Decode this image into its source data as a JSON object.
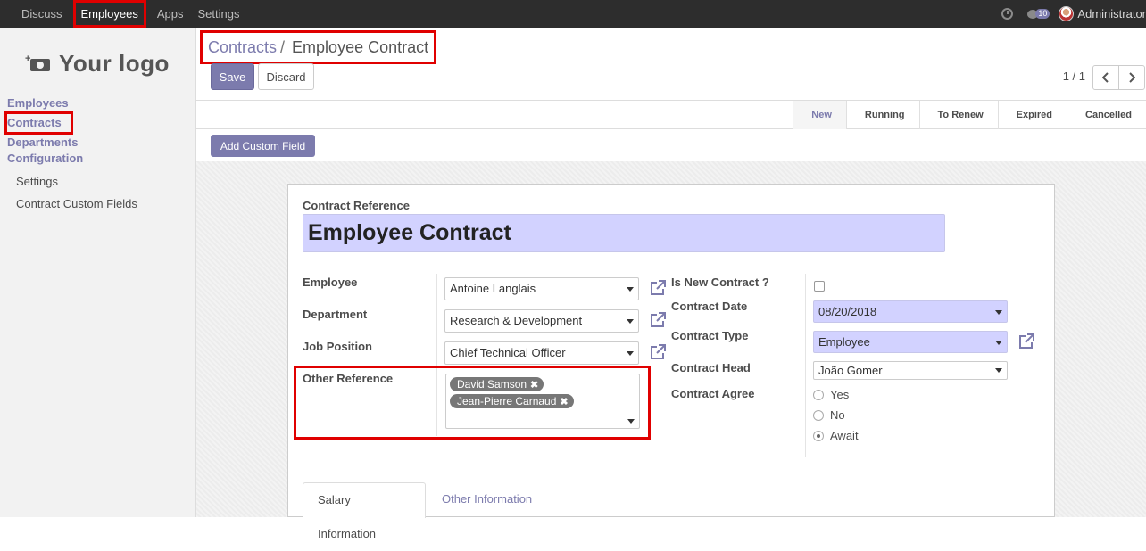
{
  "topbar": {
    "menu": [
      "Discuss",
      "Employees",
      "Apps",
      "Settings"
    ],
    "active_menu": "Employees",
    "message_count": "10",
    "user": "Administrator"
  },
  "sidebar": {
    "logo_text": "Your logo",
    "items": [
      {
        "label": "Employees"
      },
      {
        "label": "Contracts"
      },
      {
        "label": "Departments"
      },
      {
        "label": "Configuration"
      }
    ],
    "sub_items": [
      {
        "label": "Settings"
      },
      {
        "label": "Contract Custom Fields"
      }
    ]
  },
  "breadcrumb": {
    "parent": "Contracts",
    "separator": "/",
    "current": "Employee Contract"
  },
  "toolbar": {
    "save_label": "Save",
    "discard_label": "Discard",
    "pager": "1 / 1"
  },
  "stages": [
    "New",
    "Running",
    "To Renew",
    "Expired",
    "Cancelled"
  ],
  "current_stage": "New",
  "add_custom_field_label": "Add Custom Field",
  "form": {
    "reference_label": "Contract Reference",
    "reference_value": "Employee Contract",
    "left": {
      "employee_label": "Employee",
      "employee_value": "Antoine Langlais",
      "department_label": "Department",
      "department_value": "Research & Development",
      "job_label": "Job Position",
      "job_value": "Chief Technical Officer",
      "other_ref_label": "Other Reference",
      "tags": [
        "David Samson",
        "Jean-Pierre Carnaud"
      ]
    },
    "right": {
      "is_new_label": "Is New Contract ?",
      "is_new_checked": false,
      "date_label": "Contract Date",
      "date_value": "08/20/2018",
      "type_label": "Contract Type",
      "type_value": "Employee",
      "head_label": "Contract Head",
      "head_value": "João Gomer",
      "agree_label": "Contract Agree",
      "agree_options": [
        "Yes",
        "No",
        "Await"
      ],
      "agree_selected": "Await"
    },
    "tabs": [
      "Salary Information",
      "Other Information"
    ]
  },
  "colors": {
    "topbar": "#2d2d2d",
    "accent": "#7c7bad",
    "required_field": "#d2d2ff",
    "highlight": "#e00000"
  }
}
